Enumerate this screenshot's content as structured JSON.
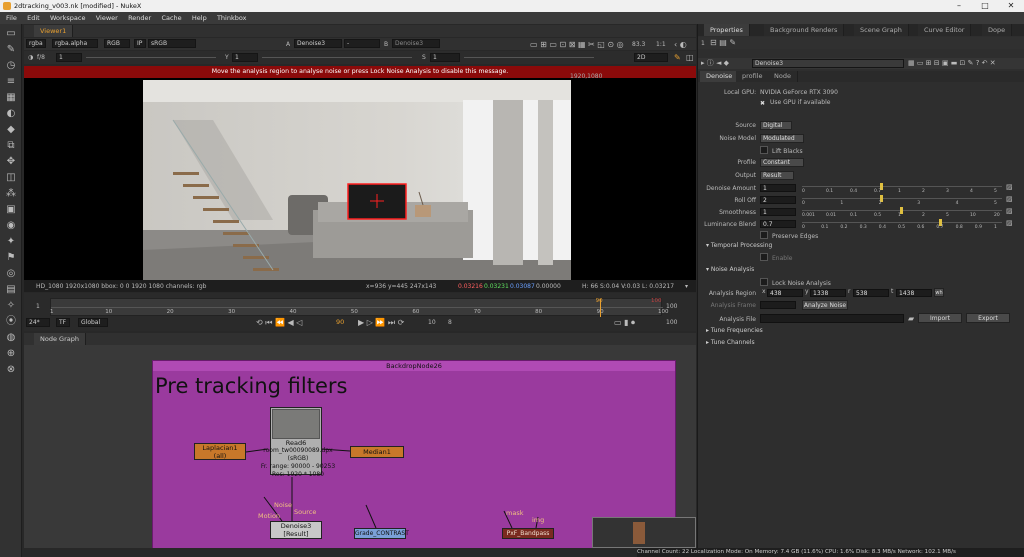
{
  "window": {
    "title": "2dtracking_v003.nk [modified] - NukeX",
    "controls": [
      "–",
      "□",
      "✕"
    ]
  },
  "menu": [
    "File",
    "Edit",
    "Workspace",
    "Viewer",
    "Render",
    "Cache",
    "Help",
    "Thinkbox"
  ],
  "viewer": {
    "tab_label": "Viewer1",
    "channels": "rgba",
    "alpha": "rgba.alpha",
    "colorspace_rgb": "RGB",
    "ip": "IP",
    "display": "sRGB",
    "input_a_label": "A",
    "input_a": "Denoise3",
    "wipe": "-",
    "input_b_label": "B",
    "input_b": "Denoise3",
    "zoom": "83.3",
    "proxy": "1:1",
    "fstop": "f/8",
    "gain_value": "1",
    "gamma_label": "Y",
    "gamma_value": "1",
    "sat_label": "S",
    "sat_value": "1",
    "view_mode": "2D",
    "warning": "Move the analysis region to analyse noise or press Lock Noise Analysis to disable this message.",
    "resolution_corner": "1920,1080",
    "info_left": "HD_1080 1920x1080  bbox: 0 0 1920 1080 channels: rgb",
    "info_coords": "x=936 y=445 247x143",
    "info_r": "0.03216",
    "info_g": "0.03231",
    "info_b": "0.03087",
    "info_a": "0.00000",
    "info_hsv": "H: 66 S:0.04 V:0.03  L: 0.03217"
  },
  "timeline": {
    "start": "1",
    "end": "100",
    "current": "90",
    "fps": "24*",
    "tf": "TF",
    "scope": "Global",
    "ticks": [
      "1",
      "10",
      "20",
      "30",
      "40",
      "50",
      "60",
      "70",
      "80",
      "90",
      "100"
    ],
    "step": "10",
    "increment": "8",
    "playhead_label": "90",
    "end_marker": "100"
  },
  "node_graph": {
    "tab_label": "Node Graph",
    "backdrop_name": "BackdropNode26",
    "backdrop_title": "Pre tracking filters",
    "read": {
      "name": "Read6",
      "file": "room_tw00090089.dpx",
      "colorspace": "(sRGB)",
      "range": "Fr. range: 90000 - 90253",
      "res": "Res: 1920 * 1080"
    },
    "laplacian": {
      "name": "Laplacian1",
      "sub": "(all)"
    },
    "median": {
      "name": "Median1"
    },
    "denoise": {
      "name": "Denoise3",
      "sub": "[Result]"
    },
    "labels": {
      "noise": "Noise",
      "motion": "Motion",
      "source": "Source",
      "mask": "mask",
      "img": "img"
    },
    "grade": {
      "name": "Grade_CONTRAST"
    },
    "pxf": {
      "name": "PxF_Bandpass"
    }
  },
  "panel_tabs": [
    "Properties",
    "Background Renders",
    "Scene Graph",
    "Curve Editor",
    "Dope"
  ],
  "properties": {
    "max_panels": "1",
    "node_name": "Denoise3",
    "subtabs": [
      "Denoise",
      "profile",
      "Node"
    ],
    "local_gpu_label": "Local GPU:",
    "local_gpu": "NVIDIA GeForce RTX 3090",
    "use_gpu": "Use GPU if available",
    "source_label": "Source",
    "source": "Digital",
    "noise_model_label": "Noise Model",
    "noise_model": "Modulated",
    "lift_blacks": "Lift Blacks",
    "profile_label": "Profile",
    "profile": "Constant",
    "output_label": "Output",
    "output": "Result",
    "sliders": [
      {
        "label": "Denoise Amount",
        "value": "1",
        "ticks": [
          "0",
          "0.1",
          "0.4",
          "0.7",
          "1",
          "2",
          "3",
          "4",
          "5"
        ],
        "level": 0.4
      },
      {
        "label": "Roll Off",
        "value": "2",
        "ticks": [
          "0",
          "1",
          "2",
          "3",
          "4",
          "5"
        ],
        "level": 0.4
      },
      {
        "label": "Smoothness",
        "value": "1",
        "ticks": [
          "0.001",
          "0.01",
          "0.1",
          "0.5",
          "1",
          "2",
          "5",
          "10",
          "20"
        ],
        "level": 0.5
      },
      {
        "label": "Luminance Blend",
        "value": "0.7",
        "ticks": [
          "0",
          "0.1",
          "0.2",
          "0.3",
          "0.4",
          "0.5",
          "0.6",
          "0.7",
          "0.8",
          "0.9",
          "1"
        ],
        "level": 0.7
      }
    ],
    "preserve_edges": "Preserve Edges",
    "temporal": "Temporal Processing",
    "enable": "Enable",
    "noise_analysis": "Noise Analysis",
    "lock_noise": "Lock Noise Analysis",
    "region_label": "Analysis Region",
    "region": [
      {
        "k": "x",
        "v": "438"
      },
      {
        "k": "y",
        "v": "1338"
      },
      {
        "k": "r",
        "v": "538"
      },
      {
        "k": "t",
        "v": "1438"
      }
    ],
    "region_wh": "wh",
    "frame_label": "Analysis Frame",
    "frame": "",
    "analyze_btn": "Analyze Noise",
    "file_label": "Analysis File",
    "import_btn": "Import",
    "export_btn": "Export",
    "tune_freq": "Tune Frequencies",
    "tune_chan": "Tune Channels"
  },
  "status_bar": "Channel Count: 22  Localization Mode: On  Memory: 7.4 GB (11.6%)  CPU: 1.6%  Disk: 8.3 MB/s  Network: 102.1 MB/s",
  "colors": {
    "accent": "#e8a030",
    "warning": "#8b0a0a",
    "backdrop": "#9a3a9e",
    "read": "#b0b0b0",
    "laplacian": "#c8782a",
    "median": "#c8782a",
    "grade": "#7aa0d8",
    "pxf": "#7a2a20"
  }
}
